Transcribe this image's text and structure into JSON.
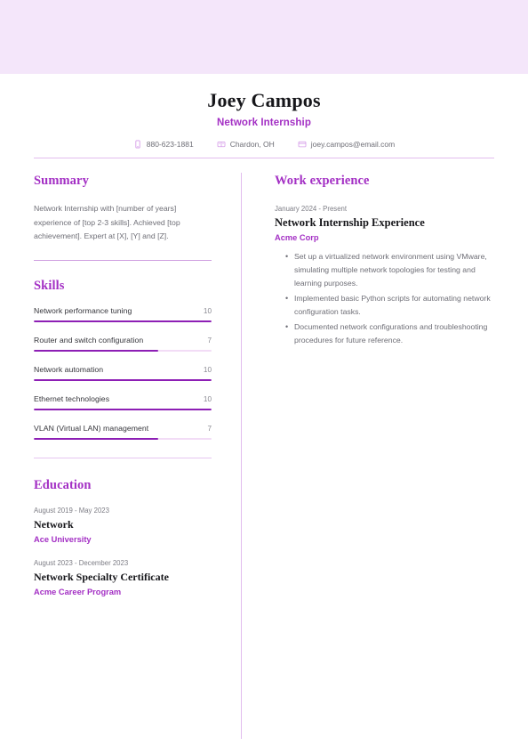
{
  "theme": {
    "banner_color": "#f4e6fa",
    "accent_color": "#a32fc4",
    "bar_fill_color": "#8d1fb5",
    "bar_track_color": "#f2dcf6",
    "rule_color": "#e2bdee",
    "body_text_color": "#6e6e76"
  },
  "header": {
    "full_name": "Joey Campos",
    "job_title": "Network Internship",
    "contacts": [
      {
        "icon": "phone-icon",
        "value": "880-623-1881"
      },
      {
        "icon": "location-icon",
        "value": "Chardon, OH"
      },
      {
        "icon": "email-icon",
        "value": "joey.campos@email.com"
      }
    ]
  },
  "left_column": {
    "summary": {
      "heading": "Summary",
      "text": "Network Internship with [number of years] experience of [top 2-3 skills]. Achieved [top achievement]. Expert at [X], [Y] and [Z]."
    },
    "skills": {
      "heading": "Skills",
      "items": [
        {
          "name": "Network performance tuning",
          "level": "10",
          "percent": 100
        },
        {
          "name": "Router and switch configuration",
          "level": "7",
          "percent": 70
        },
        {
          "name": "Network automation",
          "level": "10",
          "percent": 100
        },
        {
          "name": "Ethernet technologies",
          "level": "10",
          "percent": 100
        },
        {
          "name": "VLAN (Virtual LAN) management",
          "level": "7",
          "percent": 70
        }
      ]
    },
    "education": {
      "heading": "Education",
      "entries": [
        {
          "date": "August 2019 - May 2023",
          "title": "Network",
          "organization": "Ace University"
        },
        {
          "date": "August 2023 - December 2023",
          "title": "Network Specialty Certificate",
          "organization": "Acme Career Program"
        }
      ]
    }
  },
  "right_column": {
    "work_experience": {
      "heading": "Work experience",
      "entries": [
        {
          "date": "January 2024 - Present",
          "title": "Network Internship Experience",
          "organization": "Acme Corp",
          "bullets": [
            "Set up a virtualized network environment using VMware, simulating multiple network topologies for testing and learning purposes.",
            "Implemented basic Python scripts for automating network configuration tasks.",
            "Documented network configurations and troubleshooting procedures for future reference."
          ]
        }
      ]
    }
  }
}
